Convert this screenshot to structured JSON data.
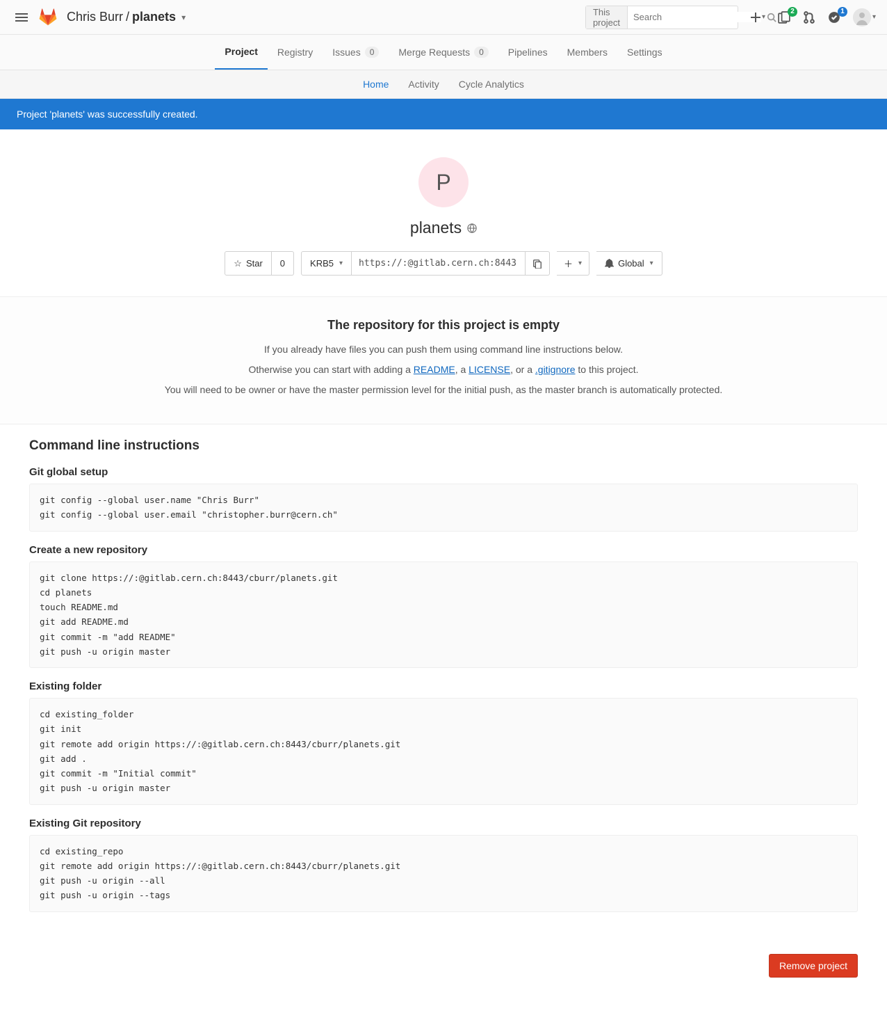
{
  "breadcrumb": {
    "owner": "Chris Burr",
    "project": "planets"
  },
  "search": {
    "scope": "This project",
    "placeholder": "Search"
  },
  "topIcons": {
    "issuesBadge": "2",
    "todosBadge": "1"
  },
  "navTabs": {
    "project": "Project",
    "registry": "Registry",
    "issues": "Issues",
    "issuesCount": "0",
    "mr": "Merge Requests",
    "mrCount": "0",
    "pipelines": "Pipelines",
    "members": "Members",
    "settings": "Settings"
  },
  "subTabs": {
    "home": "Home",
    "activity": "Activity",
    "cycle": "Cycle Analytics"
  },
  "flash": "Project 'planets' was successfully created.",
  "project": {
    "initial": "P",
    "name": "planets",
    "star": "Star",
    "starCount": "0",
    "protocol": "KRB5",
    "cloneUrl": "https://:@gitlab.cern.ch:8443",
    "global": "Global"
  },
  "empty": {
    "heading": "The repository for this project is empty",
    "p1": "If you already have files you can push them using command line instructions below.",
    "p2a": "Otherwise you can start with adding a ",
    "readme": "README",
    "p2b": ", a ",
    "license": "LICENSE",
    "p2c": ", or a ",
    "gitignore": ".gitignore",
    "p2d": " to this project.",
    "p3": "You will need to be owner or have the master permission level for the initial push, as the master branch is automatically protected."
  },
  "cli": {
    "heading": "Command line instructions",
    "h1": "Git global setup",
    "c1": "git config --global user.name \"Chris Burr\"\ngit config --global user.email \"christopher.burr@cern.ch\"",
    "h2": "Create a new repository",
    "c2": "git clone https://:@gitlab.cern.ch:8443/cburr/planets.git\ncd planets\ntouch README.md\ngit add README.md\ngit commit -m \"add README\"\ngit push -u origin master",
    "h3": "Existing folder",
    "c3": "cd existing_folder\ngit init\ngit remote add origin https://:@gitlab.cern.ch:8443/cburr/planets.git\ngit add .\ngit commit -m \"Initial commit\"\ngit push -u origin master",
    "h4": "Existing Git repository",
    "c4": "cd existing_repo\ngit remote add origin https://:@gitlab.cern.ch:8443/cburr/planets.git\ngit push -u origin --all\ngit push -u origin --tags"
  },
  "footer": {
    "remove": "Remove project"
  }
}
